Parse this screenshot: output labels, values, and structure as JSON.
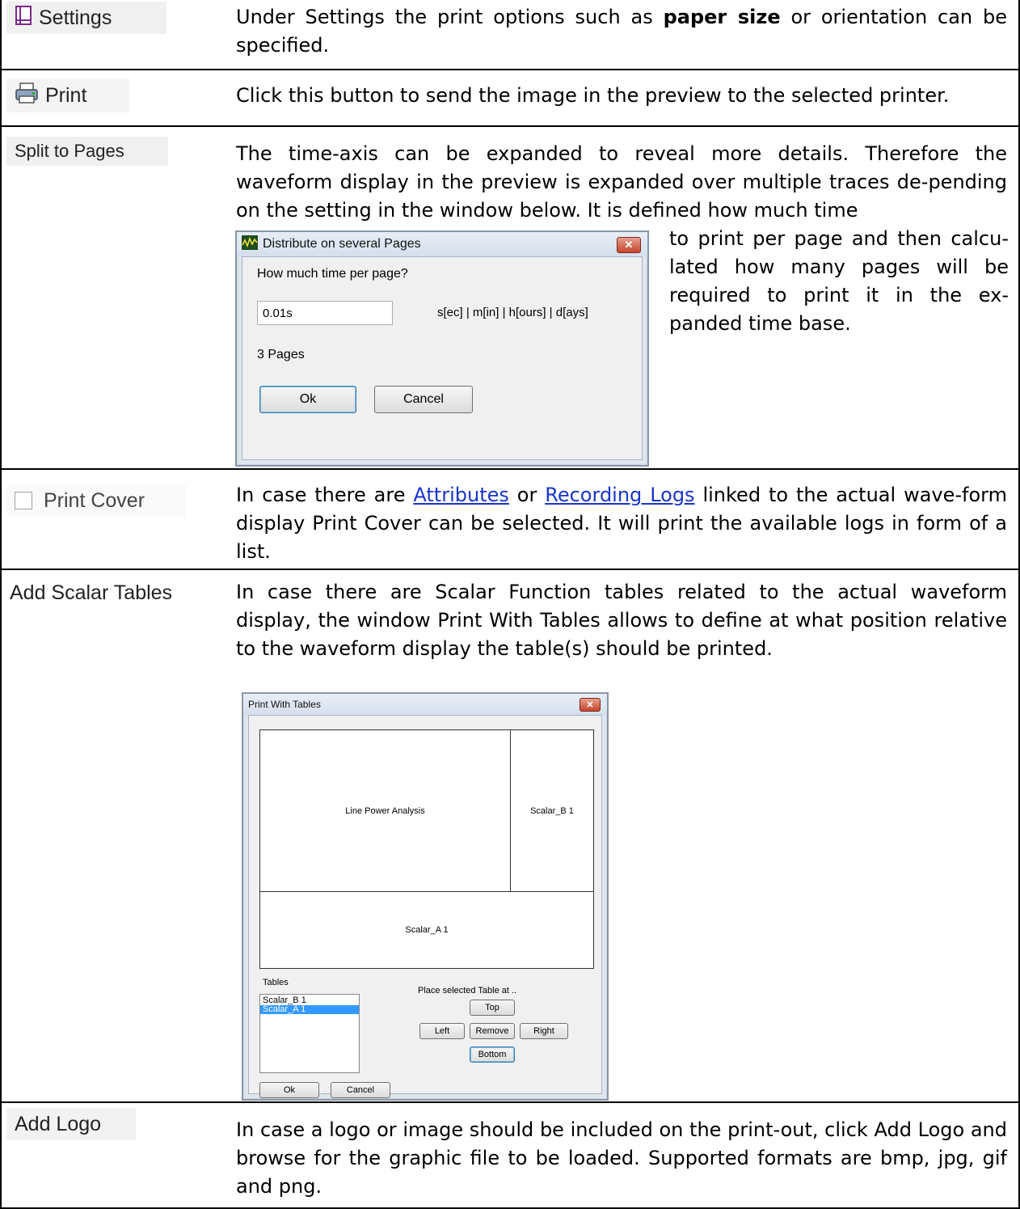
{
  "rows": {
    "settings": {
      "label": "Settings",
      "desc_before": "Under Settings the print options such as ",
      "desc_bold": "paper size",
      "desc_after": " or orientation can be specified."
    },
    "print": {
      "label": "Print",
      "desc": "Click this button to send the image in the preview to the selected printer."
    },
    "split": {
      "label": "Split to Pages",
      "desc_top": "The time-axis can be expanded to reveal more details. Therefore the waveform display in the preview is expanded over multiple traces de-pending on the setting in the window below. It is defined how much time",
      "desc_side": "to print per page and then calcu-lated how many pages will be required to print it in the ex-panded time base.",
      "dialog": {
        "title": "Distribute on several Pages",
        "close": "✕",
        "question": "How much time per page?",
        "input_value": "0.01s",
        "units": "s[ec] | m[in] | h[ours] | d[ays]",
        "pages": "3 Pages",
        "ok": "Ok",
        "cancel": "Cancel"
      }
    },
    "cover": {
      "label": "Print Cover",
      "desc_1": "In case there are ",
      "link_1": "Attributes",
      "desc_2": " or ",
      "link_2": "Recording Logs",
      "desc_3": " linked to the actual wave-form display Print Cover can be selected. It will print the available logs in form of a list."
    },
    "scalar": {
      "label": "Add Scalar Tables",
      "desc": "In case there are Scalar Function tables related to the actual waveform display, the window Print With Tables allows to define at what position relative to the waveform display the table(s) should be printed.",
      "dialog": {
        "title": "Print With Tables",
        "close": "✕",
        "main_area": "Line Power Analysis",
        "right_area": "Scalar_B 1",
        "bottom_area": "Scalar_A 1",
        "tables_label": "Tables",
        "tables": [
          "Scalar_B 1",
          "Scalar_A 1"
        ],
        "place_label": "Place selected Table at ..",
        "top": "Top",
        "left": "Left",
        "remove": "Remove",
        "right": "Right",
        "bottom": "Bottom",
        "ok": "Ok",
        "cancel": "Cancel"
      }
    },
    "logo": {
      "label": "Add Logo",
      "desc": "In case a logo or image should be included on the print-out, click Add Logo and browse for the graphic file to be loaded. Supported formats are bmp, jpg, gif and png."
    }
  },
  "colors": {
    "link": "#1a35c8",
    "selection": "#3399ff"
  }
}
